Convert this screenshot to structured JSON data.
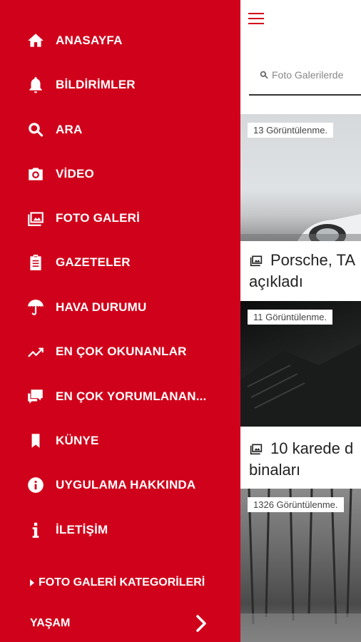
{
  "menu": {
    "items": [
      {
        "label": "ANASAYFA",
        "icon": "home-icon"
      },
      {
        "label": "BİLDİRİMLER",
        "icon": "bell-icon"
      },
      {
        "label": "ARA",
        "icon": "search-icon"
      },
      {
        "label": "VİDEO",
        "icon": "camera-icon"
      },
      {
        "label": "FOTO GALERİ",
        "icon": "image-icon"
      },
      {
        "label": "GAZETELER",
        "icon": "clipboard-icon"
      },
      {
        "label": "HAVA DURUMU",
        "icon": "umbrella-icon"
      },
      {
        "label": "EN ÇOK OKUNANLAR",
        "icon": "trending-icon"
      },
      {
        "label": "EN ÇOK YORUMLANAN...",
        "icon": "comments-icon"
      },
      {
        "label": "KÜNYE",
        "icon": "bookmark-icon"
      },
      {
        "label": "UYGULAMA HAKKINDA",
        "icon": "info-circle-icon"
      },
      {
        "label": "İLETİŞİM",
        "icon": "info-icon"
      }
    ],
    "categories_header": "FOTO GALERİ KATEGORİLERİ",
    "category_first": "YAŞAM"
  },
  "search": {
    "placeholder": "Foto Galerilerde"
  },
  "cards": [
    {
      "views": "13 Görüntülenme.",
      "title_line1": "Porsche, TA",
      "title_line2": "açıkladı"
    },
    {
      "views": "11 Görüntülenme.",
      "title_line1": "10 karede d",
      "title_line2": "binaları"
    },
    {
      "views": "1326 Görüntülenme."
    }
  ],
  "colors": {
    "brand": "#d0021b"
  }
}
